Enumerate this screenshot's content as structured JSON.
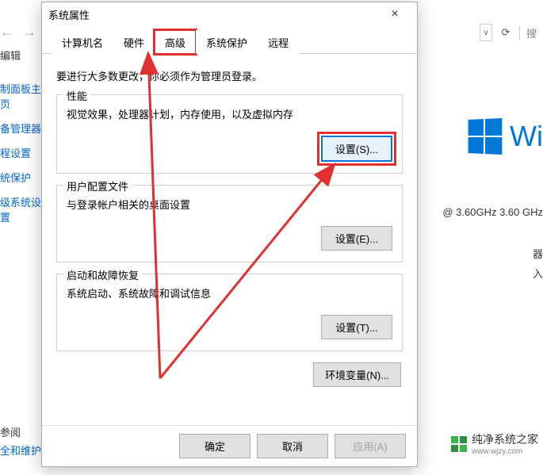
{
  "background": {
    "nav": {
      "back_arrow": "←",
      "fwd_arrow": "→",
      "up_arrow": "↑",
      "dropdown": "v",
      "refresh": "⟳",
      "search_placeholder": "搜"
    },
    "left_menu": {
      "edit_label": "编辑",
      "links": [
        "制面板主页",
        "备管理器",
        "程设置",
        "统保护",
        "级系统设置"
      ],
      "see_also_label": "参阅",
      "see_also_links": [
        "全和维护"
      ]
    },
    "right": {
      "win_text": "Wi",
      "cpu_line": "@ 3.60GHz   3.60 GHz",
      "other1": "器",
      "other2": "入"
    }
  },
  "dialog": {
    "title": "系统属性",
    "tabs": [
      "计算机名",
      "硬件",
      "高级",
      "系统保护",
      "远程"
    ],
    "active_tab_index": 2,
    "admin_note": "要进行大多数更改，你必须作为管理员登录。",
    "groups": {
      "perf": {
        "title": "性能",
        "desc": "视觉效果，处理器计划，内存使用，以及虚拟内存",
        "button": "设置(S)..."
      },
      "profile": {
        "title": "用户配置文件",
        "desc": "与登录帐户相关的桌面设置",
        "button": "设置(E)..."
      },
      "startup": {
        "title": "启动和故障恢复",
        "desc": "系统启动、系统故障和调试信息",
        "button": "设置(T)..."
      }
    },
    "env_button": "环境变量(N)...",
    "buttons": {
      "ok": "确定",
      "cancel": "取消",
      "apply": "应用(A)"
    }
  },
  "watermark": {
    "text": "纯净系统之家",
    "sub": "www.wjzy.com"
  },
  "annotations": {
    "color": "#e03030"
  }
}
